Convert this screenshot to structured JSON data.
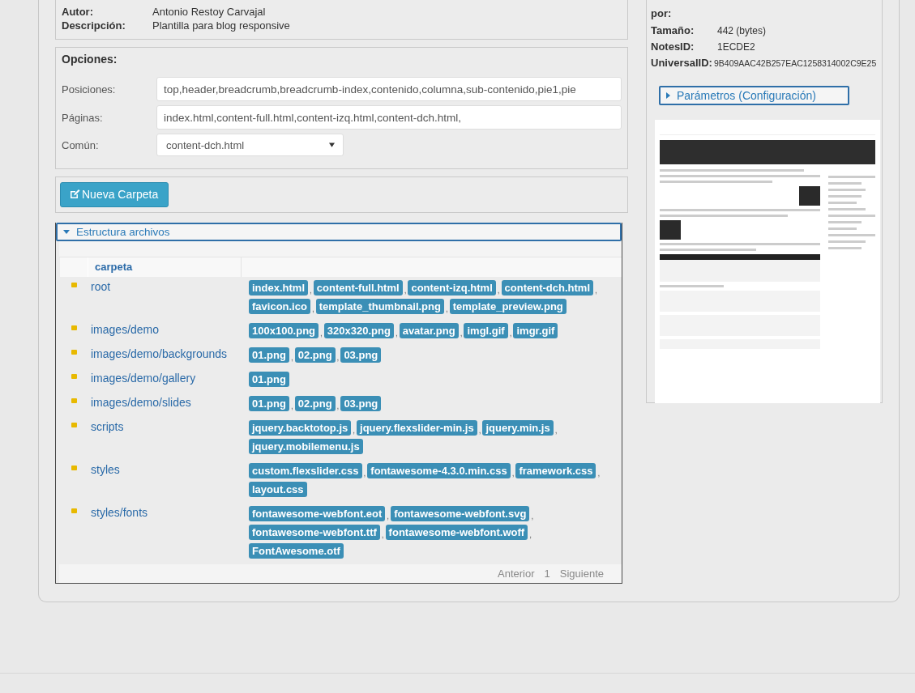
{
  "info": {
    "fields": [
      {
        "label": "Autor:",
        "value": "Antonio Restoy Carvajal"
      },
      {
        "label": "Descripción:",
        "value": "Plantilla para blog responsive"
      }
    ]
  },
  "options": {
    "title": "Opciones:",
    "fields": [
      {
        "kind": "text",
        "label": "Posiciones:",
        "value": "top,header,breadcrumb,breadcrumb-index,contenido,columna,sub-contenido,pie1,pie"
      },
      {
        "kind": "text",
        "label": "Páginas:",
        "value": "index.html,content-full.html,content-izq.html,content-dch.html,"
      },
      {
        "kind": "select",
        "label": "Común:",
        "value": "content-dch.html"
      }
    ]
  },
  "new_folder_button": {
    "label": "Nueva Carpeta"
  },
  "structure": {
    "title": "Estructura archivos",
    "expanded": true,
    "column": "carpeta",
    "separator": ",",
    "rows": [
      {
        "folder": "root",
        "files": [
          "index.html",
          "content-full.html",
          "content-izq.html",
          "content-dch.html",
          "favicon.ico",
          "template_thumbnail.png",
          "template_preview.png"
        ]
      },
      {
        "folder": "images/demo",
        "files": [
          "100x100.png",
          "320x320.png",
          "avatar.png",
          "imgl.gif",
          "imgr.gif"
        ]
      },
      {
        "folder": "images/demo/backgrounds",
        "files": [
          "01.png",
          "02.png",
          "03.png"
        ]
      },
      {
        "folder": "images/demo/gallery",
        "files": [
          "01.png"
        ]
      },
      {
        "folder": "images/demo/slides",
        "files": [
          "01.png",
          "02.png",
          "03.png"
        ]
      },
      {
        "folder": "scripts",
        "files": [
          "jquery.backtotop.js",
          "jquery.flexslider-min.js",
          "jquery.min.js",
          "jquery.mobilemenu.js"
        ]
      },
      {
        "folder": "styles",
        "files": [
          "custom.flexslider.css",
          "fontawesome-4.3.0.min.css",
          "framework.css",
          "layout.css"
        ]
      },
      {
        "folder": "styles/fonts",
        "files": [
          "fontawesome-webfont.eot",
          "fontawesome-webfont.svg",
          "fontawesome-webfont.ttf",
          "fontawesome-webfont.woff",
          "FontAwesome.otf"
        ]
      }
    ],
    "pager": {
      "prev": "Anterior",
      "page": "1",
      "next": "Siguiente"
    }
  },
  "side": {
    "top_label": "por:",
    "fields": [
      {
        "label": "Tamaño:",
        "value": "442 (bytes)"
      },
      {
        "label": "NotesID:",
        "value": "1ECDE2"
      },
      {
        "label": "UniversalID:",
        "value": "9B409AAC42B257EAC1258314002C9E25"
      }
    ],
    "params": {
      "title": "Parámetros (Configuración)",
      "expanded": false
    }
  }
}
